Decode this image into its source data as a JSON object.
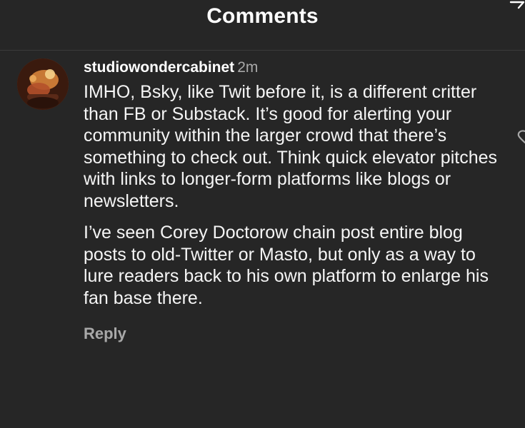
{
  "header": {
    "title": "Comments"
  },
  "comment": {
    "username": "studiowondercabinet",
    "time": "2m",
    "paragraphs": [
      "IMHO, Bsky, like Twit before it, is a different critter than FB or Substack. It’s good for alerting your community within the larger crowd that there’s something to check out. Think quick elevator pitches with links to longer-form platforms like blogs or newsletters.",
      "I’ve seen Corey Doctorow chain post entire blog posts to old-Twitter or Masto, but only as a way to lure readers back to his own platform to enlarge his fan base there."
    ],
    "reply_label": "Reply"
  },
  "icons": {
    "corner": "filter-icon",
    "like": "heart-icon"
  },
  "colors": {
    "background": "#262626",
    "text": "#f5f5f5",
    "muted": "#a8a8a8"
  }
}
